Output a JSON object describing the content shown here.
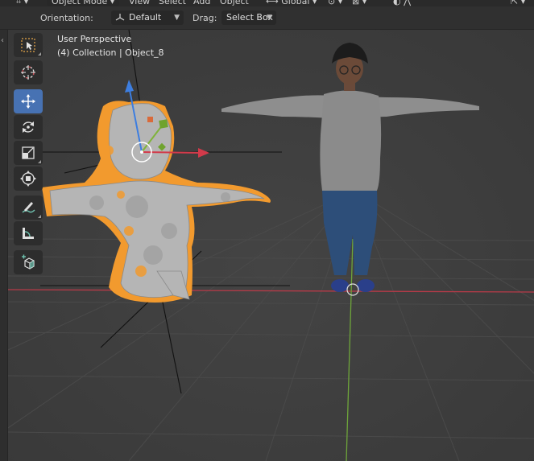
{
  "topbar": {
    "mode": "Object Mode",
    "menu_view": "View",
    "menu_select": "Select",
    "menu_add": "Add",
    "menu_object": "Object",
    "transform": "Global"
  },
  "header": {
    "orientation_label": "Orientation:",
    "orientation_value": "Default",
    "drag_label": "Drag:",
    "drag_value": "Select Box"
  },
  "viewport": {
    "view_name": "User Perspective",
    "collection_info": "(4) Collection | Object_8"
  },
  "toolbar": {
    "tools": [
      {
        "name": "select-box-tool",
        "icon": "select-box-icon",
        "active": false
      },
      {
        "name": "cursor-tool",
        "icon": "cursor-icon",
        "active": false
      },
      {
        "name": "move-tool",
        "icon": "move-icon",
        "active": true
      },
      {
        "name": "rotate-tool",
        "icon": "rotate-icon",
        "active": false
      },
      {
        "name": "scale-tool",
        "icon": "scale-icon",
        "active": false
      },
      {
        "name": "transform-tool",
        "icon": "transform-icon",
        "active": false
      },
      {
        "name": "annotate-tool",
        "icon": "annotate-icon",
        "active": false
      },
      {
        "name": "measure-tool",
        "icon": "measure-icon",
        "active": false
      },
      {
        "name": "add-cube-tool",
        "icon": "add-cube-icon",
        "active": false
      }
    ]
  },
  "colors": {
    "accent": "#4772b3",
    "selection_orange": "#f29a2e",
    "axis_x": "#d23a4a",
    "axis_y": "#7fb33a",
    "axis_z": "#3d7ee0"
  }
}
